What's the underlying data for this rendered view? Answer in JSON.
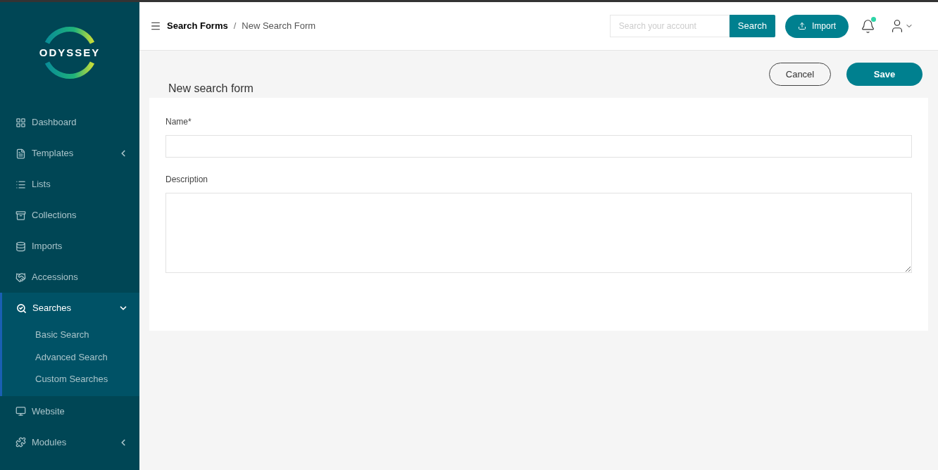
{
  "logo": {
    "text": "ODYSSEY"
  },
  "sidebar": {
    "items": [
      {
        "label": "Dashboard",
        "selected": false
      },
      {
        "label": "Templates",
        "selected": false,
        "expanded": false
      },
      {
        "label": "Lists",
        "selected": false
      },
      {
        "label": "Collections",
        "selected": false
      },
      {
        "label": "Imports",
        "selected": false
      },
      {
        "label": "Accessions",
        "selected": false
      },
      {
        "label": "Searches",
        "selected": true,
        "expanded": true,
        "children": [
          {
            "label": "Basic Search",
            "selected": false
          },
          {
            "label": "Advanced Search",
            "selected": false
          },
          {
            "label": "Custom Searches",
            "selected": false
          }
        ]
      },
      {
        "label": "Website",
        "selected": false
      },
      {
        "label": "Modules",
        "selected": false,
        "expanded": false
      }
    ]
  },
  "header": {
    "breadcrumb": [
      "Search Forms",
      "/",
      "New Search Form"
    ],
    "search": {
      "placeholder": "Search your account",
      "button": "Search"
    },
    "import_button": "Import",
    "notifications": {
      "unread": true
    }
  },
  "page": {
    "title": "New search form",
    "cancel": "Cancel",
    "save": "Save",
    "fields": [
      {
        "label": "Name*",
        "kind": "input"
      },
      {
        "label": "Description",
        "kind": "textarea"
      }
    ]
  }
}
